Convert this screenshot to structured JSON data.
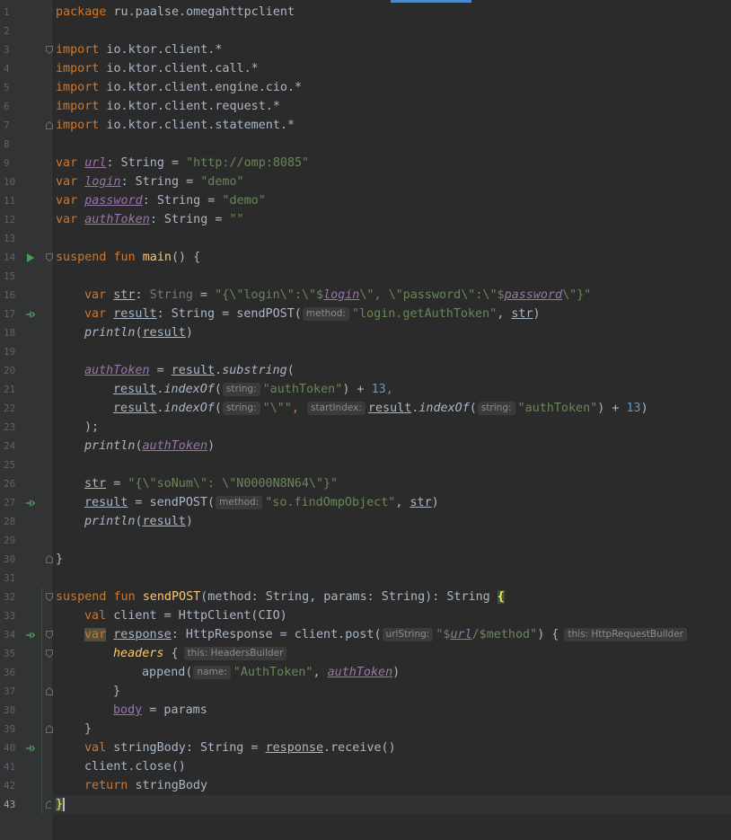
{
  "editor": {
    "file_language": "Kotlin",
    "current_line": 43,
    "colors": {
      "background": "#2b2b2b",
      "keyword": "#cc7832",
      "string": "#6a8759",
      "number": "#6897bb",
      "function": "#ffc66d",
      "property": "#9876aa",
      "text": "#a9b7c6"
    },
    "icons": {
      "run_line": 14,
      "suspend_call_lines": [
        17,
        27,
        34,
        40
      ]
    },
    "lines": {
      "l1": {
        "n": "1",
        "kw": "package",
        "rest": " ru.paalse.omegahttpclient"
      },
      "l3": {
        "n": "3",
        "kw": "import",
        "rest": " io.ktor.client.*"
      },
      "l4": {
        "n": "4",
        "kw": "import",
        "rest": " io.ktor.client.call.*"
      },
      "l5": {
        "n": "5",
        "kw": "import",
        "rest": " io.ktor.client.engine.cio.*"
      },
      "l6": {
        "n": "6",
        "kw": "import",
        "rest": " io.ktor.client.request.*"
      },
      "l7": {
        "n": "7",
        "kw": "import",
        "rest": " io.ktor.client.statement.*"
      },
      "l9": {
        "n": "9",
        "kw": "var ",
        "name": "url",
        "type": ": String = ",
        "value": "\"http://omp:8085\""
      },
      "l10": {
        "n": "10",
        "kw": "var ",
        "name": "login",
        "type": ": String = ",
        "value": "\"demo\""
      },
      "l11": {
        "n": "11",
        "kw": "var ",
        "name": "password",
        "type": ": String = ",
        "value": "\"demo\""
      },
      "l12": {
        "n": "12",
        "kw": "var ",
        "name": "authToken",
        "type": ": String = ",
        "value": "\"\""
      },
      "l14": {
        "n": "14",
        "kw1": "suspend ",
        "kw2": "fun ",
        "fn": "main",
        "rest": "() {"
      },
      "l16": {
        "n": "16",
        "kw": "var ",
        "name": "str",
        "type": ": ",
        "typename": "String",
        "eq": " = ",
        "s1": "\"{\\\"login\\\":\\\"$",
        "v1": "login",
        "s2": "\\\", \\\"password\\\":\\\"$",
        "v2": "password",
        "s3": "\\\"}\""
      },
      "l17": {
        "n": "17",
        "kw": "var ",
        "name": "result",
        "type": ": String = sendPOST(",
        "hint": "method:",
        "value": "\"login.getAuthToken\"",
        "sep": ", ",
        "arg": "str",
        "end": ")"
      },
      "l18": {
        "n": "18",
        "fn": "println",
        "open": "(",
        "arg": "result",
        "end": ")"
      },
      "l20": {
        "n": "20",
        "prop": "authToken",
        "eq": " = ",
        "obj": "result",
        "dot": ".",
        "call": "substring",
        "open": "("
      },
      "l21": {
        "n": "21",
        "obj": "result",
        "dot": ".",
        "call": "indexOf",
        "open": "(",
        "hint": "string:",
        "value": "\"authToken\"",
        "plus": ") + ",
        "num": "13",
        "end": ","
      },
      "l22": {
        "n": "22",
        "obj": "result",
        "dot": ".",
        "call": "indexOf",
        "open": "(",
        "hint": "string:",
        "value": "\"\\\"\"",
        "sep": ", ",
        "hint2": "startIndex:",
        "obj2": "result",
        "dot2": ".",
        "call2": "indexOf",
        "open2": "(",
        "hint3": "string:",
        "value2": "\"authToken\"",
        "plus": ") + ",
        "num": "13",
        "end": ")"
      },
      "l23": {
        "n": "23",
        "text": ");"
      },
      "l24": {
        "n": "24",
        "fn": "println",
        "open": "(",
        "prop": "authToken",
        "end": ")"
      },
      "l26": {
        "n": "26",
        "name": "str",
        "eq": " = ",
        "s1": "\"{\\\"soNum\\\": \\\"N0000N8N64\\\"}\""
      },
      "l27": {
        "n": "27",
        "name": "result",
        "eq": " = sendPOST(",
        "hint": "method:",
        "value": "\"so.findOmpObject\"",
        "sep": ", ",
        "arg": "str",
        "end": ")"
      },
      "l28": {
        "n": "28",
        "fn": "println",
        "open": "(",
        "arg": "result",
        "end": ")"
      },
      "l30": {
        "n": "30",
        "text": "}"
      },
      "l32": {
        "n": "32",
        "kw1": "suspend ",
        "kw2": "fun ",
        "fn": "sendPOST",
        "rest": "(method: String, params: String): String ",
        "brace": "{"
      },
      "l33": {
        "n": "33",
        "kw": "val ",
        "rest": "client = HttpClient(CIO)"
      },
      "l34": {
        "n": "34",
        "kw": "var",
        "sp": " ",
        "name": "response",
        "mid": ": HttpResponse = client.post(",
        "hint": "urlString:",
        "s1": "\"$",
        "v1": "url",
        "s2": "/$method\"",
        "end": ") {",
        "thishint": "this: HttpRequestBuilder"
      },
      "l35": {
        "n": "35",
        "ext": "headers",
        "rest": " {",
        "thishint": "this: HeadersBuilder"
      },
      "l36": {
        "n": "36",
        "rest": "append(",
        "hint": "name:",
        "value": "\"AuthToken\"",
        "sep": ", ",
        "prop": "authToken",
        "end": ")"
      },
      "l37": {
        "n": "37",
        "text": "}"
      },
      "l38": {
        "n": "38",
        "prop": "body",
        "rest": " = params"
      },
      "l39": {
        "n": "39",
        "text": "}"
      },
      "l40": {
        "n": "40",
        "kw": "val ",
        "rest": "stringBody: String = ",
        "name": "response",
        "end": ".receive()"
      },
      "l41": {
        "n": "41",
        "text": "client.close()"
      },
      "l42": {
        "n": "42",
        "kw": "return ",
        "rest": "stringBody"
      },
      "l43": {
        "n": "43",
        "brace": "}"
      }
    },
    "blank_lines": [
      "2",
      "8",
      "13",
      "15",
      "19",
      "25",
      "29",
      "31"
    ]
  }
}
